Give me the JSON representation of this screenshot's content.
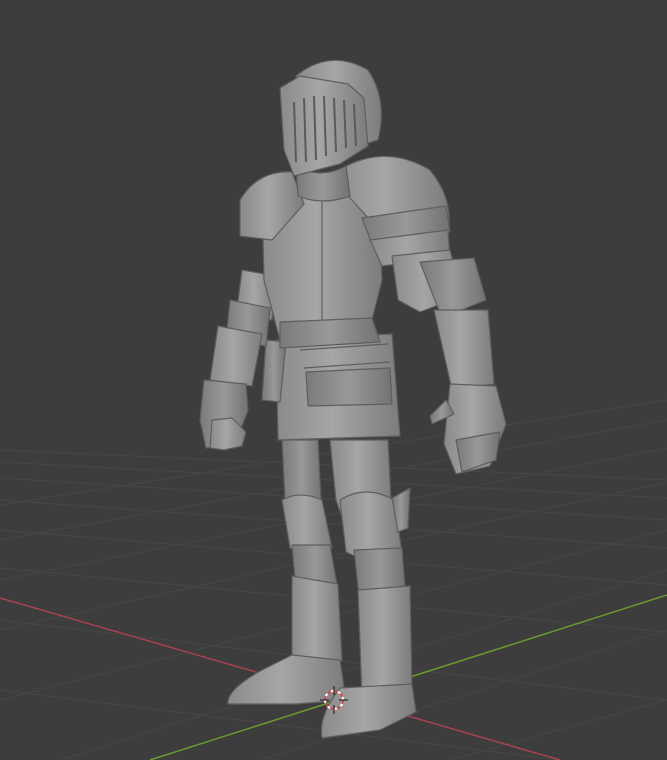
{
  "viewport": {
    "background": "#3d3d3d",
    "grid_color": "#4a4a4a",
    "x_axis_color": "#a8424f",
    "y_axis_color": "#6b9a2e",
    "model_color": "#9a9a9a",
    "model_shadow": "#6e6e6e",
    "model_highlight": "#b7b7b7"
  },
  "scene": {
    "object": "knight-armor-model",
    "cursor_icon": "3d-cursor-icon"
  }
}
